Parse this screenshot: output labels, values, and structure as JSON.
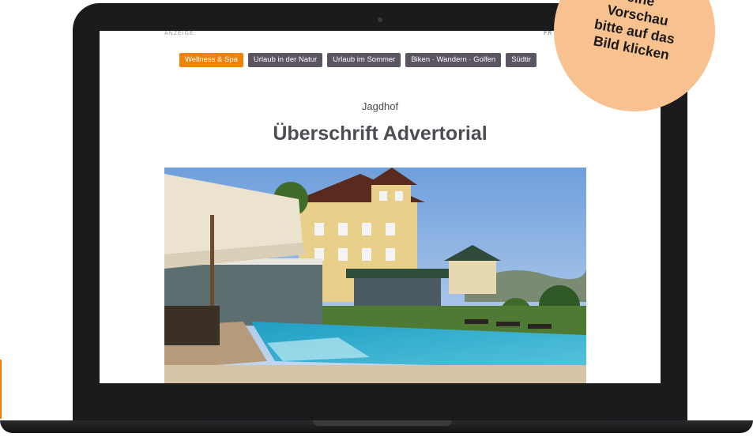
{
  "ad": {
    "label": "ANZEIGE",
    "right_label": "FR"
  },
  "nav": {
    "tabs": [
      {
        "label": "Wellness & Spa",
        "active": true
      },
      {
        "label": "Urlaub in der Natur",
        "active": false
      },
      {
        "label": "Urlaub im Sommer",
        "active": false
      },
      {
        "label": "Biken · Wandern · Golfen",
        "active": false
      },
      {
        "label": "Südtir",
        "active": false
      }
    ]
  },
  "article": {
    "subtitle": "Jagdhof",
    "headline": "Überschrift Advertorial"
  },
  "badge": {
    "lines": [
      "eine",
      "Vorschau",
      "bitte auf das",
      "Bild klicken"
    ]
  },
  "colors": {
    "accent": "#f0820a",
    "tab_bg": "#5a5560",
    "badge": "#f7c28f",
    "headline": "#4e4b53"
  }
}
